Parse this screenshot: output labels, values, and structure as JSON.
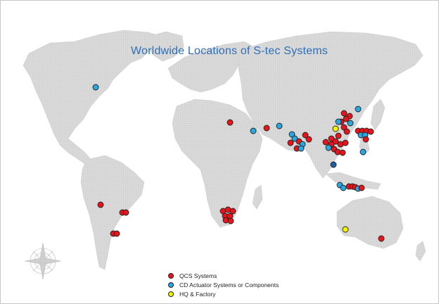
{
  "map": {
    "title": "Worldwide Locations of S-tec Systems"
  },
  "legend": {
    "items": [
      {
        "label": "QCS Systems",
        "color": "#e8141c"
      },
      {
        "label": "CD Actuator Systems or Components",
        "color": "#29a8e0"
      },
      {
        "label": "HQ & Factory",
        "color": "#f4f400"
      }
    ]
  },
  "colors": {
    "land": "#d6d6d6",
    "ocean": "#ffffff",
    "title": "#2f6fb8",
    "marker_outline": "#222222"
  },
  "icons": [
    "compass-rose-icon"
  ]
}
